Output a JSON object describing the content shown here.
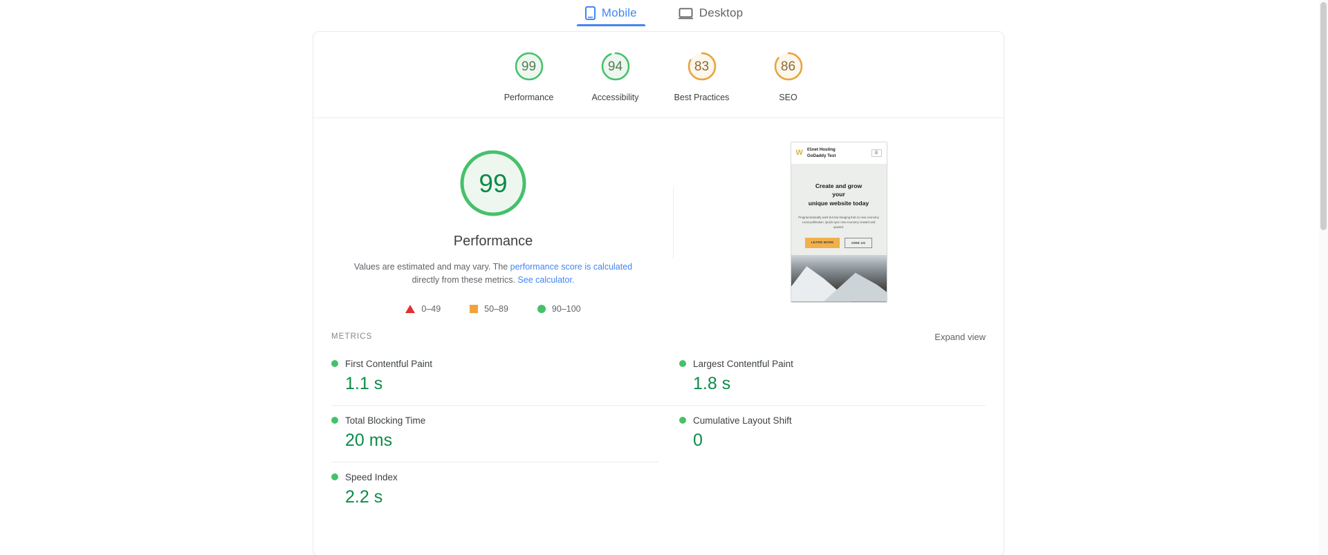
{
  "tabs": [
    {
      "label": "Mobile",
      "icon": "mobile-icon",
      "active": true
    },
    {
      "label": "Desktop",
      "icon": "desktop-icon",
      "active": false
    }
  ],
  "category_scores": [
    {
      "label": "Performance",
      "score": "99",
      "color": "#45c16a",
      "text_color": "#4f7f52",
      "fill": "#eef7ef",
      "pct": 99
    },
    {
      "label": "Accessibility",
      "score": "94",
      "color": "#45c16a",
      "text_color": "#4f7f52",
      "fill": "#eef7ef",
      "pct": 94
    },
    {
      "label": "Best Practices",
      "score": "83",
      "color": "#e8a33d",
      "text_color": "#8a6a3a",
      "fill": "#fdf6ea",
      "pct": 83
    },
    {
      "label": "SEO",
      "score": "86",
      "color": "#e8a33d",
      "text_color": "#8a6a3a",
      "fill": "#fdf6ea",
      "pct": 86
    }
  ],
  "hero": {
    "score": "99",
    "title": "Performance",
    "pct": 99,
    "color": "#45c16a",
    "fill": "#eef7ef",
    "desc_before": "Values are estimated and may vary. The ",
    "link_one": "performance score is calculated",
    "desc_middle": " directly from these metrics. ",
    "link_two": "See calculator.",
    "legend": [
      {
        "shape": "triangle",
        "range": "0–49",
        "color": "#e03030"
      },
      {
        "shape": "square",
        "range": "50–89",
        "color": "#f0a33a"
      },
      {
        "shape": "circle",
        "range": "90–100",
        "color": "#45c16a"
      }
    ]
  },
  "thumbnail": {
    "logo": "W",
    "brand_line1": "01net Hosting",
    "brand_line2": "GoDaddy Test",
    "menu_icon": "hamburger-icon",
    "headline_line1": "Create and grow",
    "headline_line2": "your",
    "headline_line3": "unique website today",
    "paragraph": "Programmatically work but low hanging fruit so new economy cross-pollination. Quick sync new economy onward and upward.",
    "button_primary": "LEARN MORE",
    "button_secondary": "HIRE US"
  },
  "metrics": {
    "section_label": "METRICS",
    "expand_label": "Expand view",
    "items": [
      {
        "label": "First Contentful Paint",
        "value": "1.1 s",
        "status_color": "#45c16a",
        "value_color": "#0c8b48"
      },
      {
        "label": "Largest Contentful Paint",
        "value": "1.8 s",
        "status_color": "#45c16a",
        "value_color": "#0c8b48"
      },
      {
        "label": "Total Blocking Time",
        "value": "20 ms",
        "status_color": "#45c16a",
        "value_color": "#0c8b48"
      },
      {
        "label": "Cumulative Layout Shift",
        "value": "0",
        "status_color": "#45c16a",
        "value_color": "#0c8b48"
      },
      {
        "label": "Speed Index",
        "value": "2.2 s",
        "status_color": "#45c16a",
        "value_color": "#0c8b48"
      }
    ]
  }
}
